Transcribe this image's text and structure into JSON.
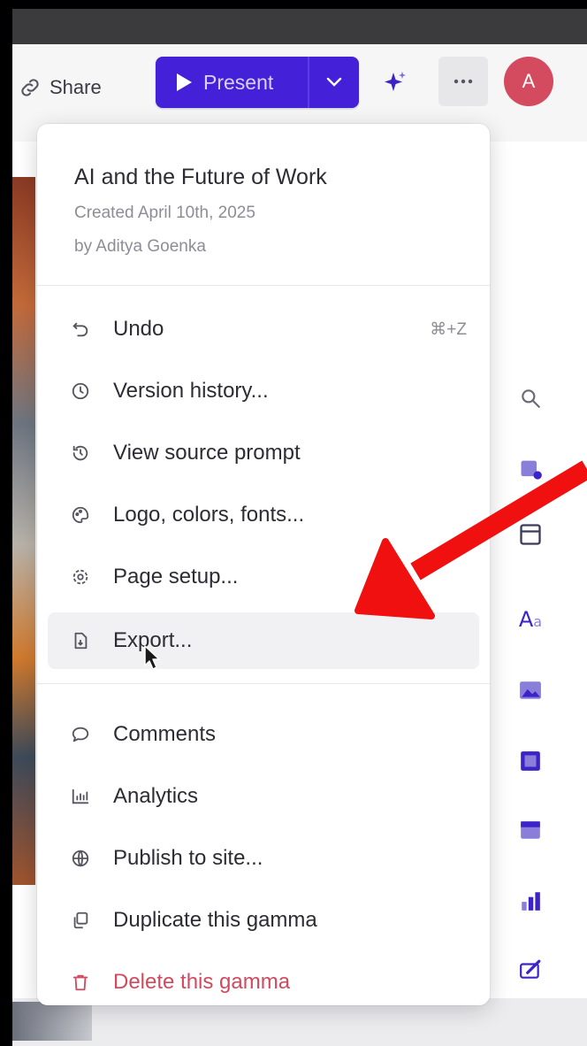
{
  "toolbar": {
    "share_label": "Share",
    "present_label": "Present",
    "avatar_initial": "A"
  },
  "menu": {
    "doc_title": "AI and the Future of Work",
    "doc_created": "Created April 10th, 2025",
    "doc_by": "by Aditya Goenka",
    "items": [
      {
        "label": "Undo",
        "shortcut": "⌘+Z",
        "icon": "undo-icon"
      },
      {
        "label": "Version history...",
        "icon": "clock-icon"
      },
      {
        "label": "View source prompt",
        "icon": "history-icon"
      },
      {
        "label": "Logo, colors, fonts...",
        "icon": "palette-icon"
      },
      {
        "label": "Page setup...",
        "icon": "gear-icon"
      },
      {
        "label": "Export...",
        "icon": "file-export-icon"
      },
      {
        "label": "Comments",
        "icon": "comment-icon"
      },
      {
        "label": "Analytics",
        "icon": "chart-icon"
      },
      {
        "label": "Publish to site...",
        "icon": "globe-icon"
      },
      {
        "label": "Duplicate this gamma",
        "icon": "duplicate-icon"
      },
      {
        "label": "Delete this gamma",
        "icon": "trash-icon"
      }
    ]
  },
  "colors": {
    "accent": "#4420d8",
    "danger": "#d14a5e",
    "avatar": "#d44a5e",
    "annotation_arrow": "#f01010"
  }
}
